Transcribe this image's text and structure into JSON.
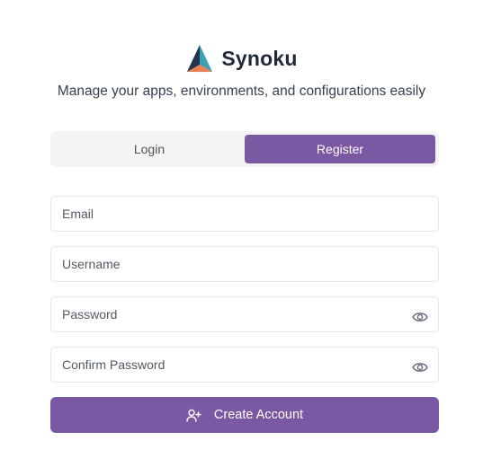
{
  "brand": {
    "name": "Synoku",
    "tagline": "Manage your apps, environments, and configurations easily"
  },
  "tabs": [
    {
      "label": "Login",
      "active": false
    },
    {
      "label": "Register",
      "active": true
    }
  ],
  "form": {
    "email_placeholder": "Email",
    "username_placeholder": "Username",
    "password_placeholder": "Password",
    "confirm_password_placeholder": "Confirm Password",
    "submit_label": "Create Account"
  },
  "icons": {
    "password_toggle": "eye-icon",
    "submit": "user-plus-icon"
  },
  "colors": {
    "accent": "#7b58a3",
    "logo_teal": "#36a3b4",
    "logo_orange": "#ef7f4d",
    "logo_dark": "#1f3550"
  }
}
